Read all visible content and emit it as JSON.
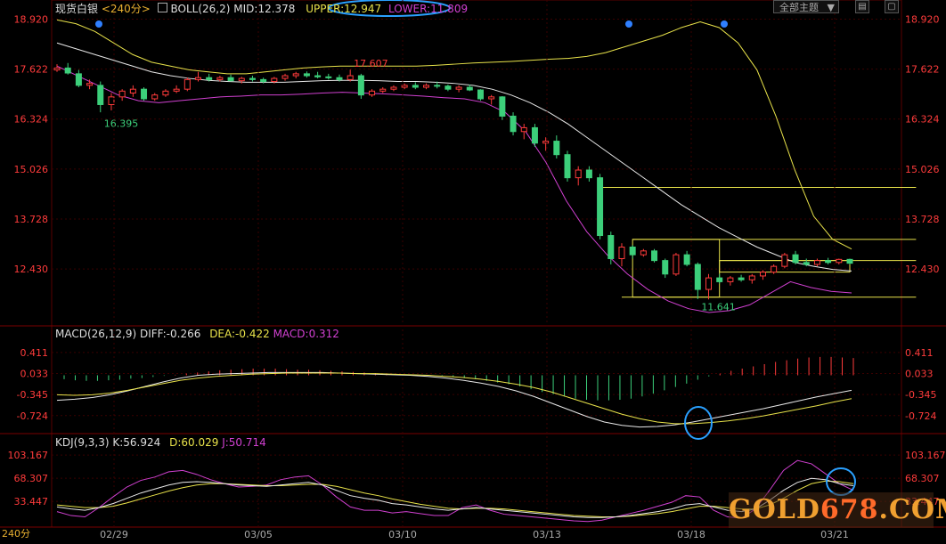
{
  "header": {
    "symbol": "现货白银",
    "period": "<240分>",
    "boll_label": "BOLL(26,2)",
    "mid_label": "MID:12.378",
    "upper_label": "UPPER:12.947",
    "lower_label": "LOWER:11.809",
    "theme_button": "全部主题",
    "win_buttons": [
      "▤",
      "▢"
    ]
  },
  "macd": {
    "label": "MACD(26,12,9)",
    "diff": "DIFF:-0.266",
    "dea": "DEA:-0.422",
    "macd": "MACD:0.312"
  },
  "kdj": {
    "label": "KDJ(9,3,3)",
    "k": "K:56.924",
    "d": "D:60.029",
    "j": "J:50.714"
  },
  "footer": {
    "period_tag": "240分"
  },
  "watermark": {
    "part1": "GOLD",
    "part2": "678",
    "part3": ".COM"
  },
  "colors": {
    "bull": "#ff3b3b",
    "bear": "#3ccf7a",
    "boll_upper": "#e8e24a",
    "boll_mid": "#e8e8e8",
    "boll_lower": "#d040d0",
    "axis_text": "#ff3b3b",
    "grid": "#3a0000",
    "annot": "#2f80ff"
  },
  "chart_data": [
    {
      "type": "candlestick",
      "title": "现货白银 240分",
      "y_ticks": [
        "18.920",
        "17.622",
        "16.324",
        "15.026",
        "13.728",
        "12.430"
      ],
      "ylim": [
        11.0,
        19.0
      ],
      "x_tick_labels": [
        "02/29",
        "03/05",
        "03/10",
        "03/13",
        "03/18",
        "03/21"
      ],
      "annotations": [
        {
          "text": "17.607",
          "x": 27,
          "y": 17.607,
          "color": "#ff3b3b"
        },
        {
          "text": "16.395",
          "x": 4,
          "y": 16.395,
          "color": "#3ccf7a"
        },
        {
          "text": "11.641",
          "x": 59,
          "y": 11.641,
          "color": "#3ccf7a"
        }
      ],
      "ohlc": [
        [
          17.6,
          17.75,
          17.55,
          17.65
        ],
        [
          17.65,
          17.78,
          17.48,
          17.52
        ],
        [
          17.5,
          17.6,
          17.15,
          17.2
        ],
        [
          17.2,
          17.35,
          17.1,
          17.25
        ],
        [
          17.2,
          17.3,
          16.5,
          16.7
        ],
        [
          16.7,
          17.0,
          16.55,
          16.9
        ],
        [
          16.9,
          17.1,
          16.8,
          17.05
        ],
        [
          17.0,
          17.2,
          16.9,
          17.1
        ],
        [
          17.1,
          17.15,
          16.8,
          16.85
        ],
        [
          16.85,
          17.0,
          16.8,
          16.95
        ],
        [
          16.95,
          17.1,
          16.9,
          17.05
        ],
        [
          17.05,
          17.2,
          17.0,
          17.1
        ],
        [
          17.1,
          17.4,
          17.05,
          17.35
        ],
        [
          17.35,
          17.55,
          17.3,
          17.4
        ],
        [
          17.4,
          17.5,
          17.3,
          17.35
        ],
        [
          17.35,
          17.45,
          17.3,
          17.4
        ],
        [
          17.4,
          17.48,
          17.3,
          17.32
        ],
        [
          17.32,
          17.42,
          17.25,
          17.38
        ],
        [
          17.38,
          17.45,
          17.3,
          17.35
        ],
        [
          17.35,
          17.4,
          17.25,
          17.3
        ],
        [
          17.3,
          17.42,
          17.25,
          17.38
        ],
        [
          17.38,
          17.5,
          17.32,
          17.45
        ],
        [
          17.45,
          17.55,
          17.38,
          17.5
        ],
        [
          17.5,
          17.56,
          17.4,
          17.45
        ],
        [
          17.45,
          17.55,
          17.38,
          17.42
        ],
        [
          17.42,
          17.5,
          17.35,
          17.4
        ],
        [
          17.4,
          17.48,
          17.3,
          17.35
        ],
        [
          17.35,
          17.607,
          17.3,
          17.45
        ],
        [
          17.45,
          17.5,
          16.85,
          16.95
        ],
        [
          16.95,
          17.1,
          16.9,
          17.05
        ],
        [
          17.05,
          17.15,
          17.0,
          17.1
        ],
        [
          17.1,
          17.2,
          17.05,
          17.15
        ],
        [
          17.15,
          17.25,
          17.1,
          17.2
        ],
        [
          17.2,
          17.28,
          17.1,
          17.15
        ],
        [
          17.15,
          17.25,
          17.1,
          17.2
        ],
        [
          17.2,
          17.3,
          17.12,
          17.18
        ],
        [
          17.18,
          17.22,
          17.05,
          17.1
        ],
        [
          17.1,
          17.2,
          17.02,
          17.15
        ],
        [
          17.15,
          17.22,
          17.05,
          17.08
        ],
        [
          17.08,
          17.1,
          16.8,
          16.85
        ],
        [
          16.85,
          16.95,
          16.7,
          16.9
        ],
        [
          16.9,
          16.92,
          16.3,
          16.4
        ],
        [
          16.4,
          16.5,
          15.9,
          16.0
        ],
        [
          16.0,
          16.2,
          15.8,
          16.1
        ],
        [
          16.1,
          16.2,
          15.6,
          15.7
        ],
        [
          15.7,
          15.85,
          15.5,
          15.75
        ],
        [
          15.75,
          15.9,
          15.3,
          15.4
        ],
        [
          15.4,
          15.5,
          14.7,
          14.8
        ],
        [
          14.8,
          15.1,
          14.6,
          15.0
        ],
        [
          15.0,
          15.1,
          14.7,
          14.8
        ],
        [
          14.8,
          14.9,
          13.2,
          13.3
        ],
        [
          13.3,
          13.4,
          12.55,
          12.7
        ],
        [
          12.7,
          13.1,
          12.5,
          13.0
        ],
        [
          13.0,
          13.05,
          12.7,
          12.8
        ],
        [
          12.8,
          12.95,
          12.75,
          12.9
        ],
        [
          12.9,
          12.95,
          12.6,
          12.65
        ],
        [
          12.65,
          12.7,
          12.2,
          12.3
        ],
        [
          12.3,
          12.85,
          12.25,
          12.8
        ],
        [
          12.8,
          12.9,
          12.5,
          12.55
        ],
        [
          12.55,
          12.6,
          11.65,
          11.9
        ],
        [
          11.9,
          12.3,
          11.641,
          12.2
        ],
        [
          12.2,
          12.3,
          12.05,
          12.1
        ],
        [
          12.1,
          12.25,
          12.0,
          12.2
        ],
        [
          12.2,
          12.28,
          12.1,
          12.15
        ],
        [
          12.15,
          12.3,
          12.05,
          12.25
        ],
        [
          12.25,
          12.4,
          12.15,
          12.35
        ],
        [
          12.35,
          12.55,
          12.3,
          12.5
        ],
        [
          12.5,
          12.85,
          12.45,
          12.8
        ],
        [
          12.8,
          12.9,
          12.55,
          12.6
        ],
        [
          12.6,
          12.7,
          12.5,
          12.55
        ],
        [
          12.55,
          12.7,
          12.5,
          12.65
        ],
        [
          12.65,
          12.72,
          12.55,
          12.6
        ],
        [
          12.6,
          12.7,
          12.55,
          12.68
        ],
        [
          12.68,
          12.7,
          12.55,
          12.58
        ]
      ],
      "boll": {
        "upper": [
          18.9,
          18.8,
          18.6,
          18.3,
          18.0,
          17.8,
          17.7,
          17.6,
          17.55,
          17.5,
          17.5,
          17.55,
          17.6,
          17.65,
          17.68,
          17.7,
          17.7,
          17.7,
          17.7,
          17.7,
          17.72,
          17.75,
          17.78,
          17.8,
          17.82,
          17.85,
          17.88,
          17.9,
          17.95,
          18.05,
          18.2,
          18.35,
          18.5,
          18.7,
          18.85,
          18.7,
          18.3,
          17.6,
          16.4,
          15.0,
          13.8,
          13.2,
          12.95
        ],
        "mid": [
          18.3,
          18.15,
          18.0,
          17.85,
          17.7,
          17.55,
          17.45,
          17.38,
          17.33,
          17.3,
          17.28,
          17.28,
          17.28,
          17.3,
          17.32,
          17.33,
          17.33,
          17.32,
          17.3,
          17.3,
          17.28,
          17.25,
          17.2,
          17.1,
          16.95,
          16.75,
          16.5,
          16.2,
          15.85,
          15.5,
          15.15,
          14.8,
          14.45,
          14.1,
          13.8,
          13.5,
          13.25,
          13.0,
          12.8,
          12.6,
          12.5,
          12.42,
          12.378
        ],
        "lower": [
          17.7,
          17.45,
          17.2,
          16.95,
          16.8,
          16.75,
          16.8,
          16.85,
          16.9,
          16.92,
          16.95,
          16.95,
          16.97,
          17.0,
          17.02,
          17.0,
          16.98,
          16.95,
          16.92,
          16.88,
          16.85,
          16.75,
          16.5,
          16.0,
          15.2,
          14.2,
          13.4,
          12.8,
          12.3,
          11.9,
          11.6,
          11.4,
          11.3,
          11.35,
          11.5,
          11.8,
          12.1,
          11.95,
          11.85,
          11.809
        ],
        "upper_start": 4,
        "lower_start": 4
      },
      "levels": [
        {
          "y": 14.55,
          "x0": 50,
          "x1": 75
        },
        {
          "y": 13.2,
          "x0": 53,
          "x1": 75
        },
        {
          "y": 12.65,
          "x0": 61,
          "x1": 75
        },
        {
          "y": 11.7,
          "x0": 52,
          "x1": 75
        }
      ],
      "boxes": [
        {
          "x0": 53,
          "x1": 61,
          "y0": 11.7,
          "y1": 13.2
        },
        {
          "x0": 61,
          "x1": 73,
          "y0": 12.35,
          "y1": 12.65
        }
      ]
    },
    {
      "type": "bar",
      "title": "MACD(26,12,9)",
      "y_ticks": [
        "0.411",
        "0.033",
        "-0.345",
        "-0.724"
      ],
      "ylim": [
        -1.0,
        0.6
      ],
      "hist": [
        -0.07,
        -0.09,
        -0.1,
        -0.1,
        -0.09,
        -0.08,
        -0.06,
        -0.05,
        -0.03,
        -0.01,
        0.01,
        0.03,
        0.05,
        0.07,
        0.09,
        0.1,
        0.11,
        0.12,
        0.12,
        0.12,
        0.11,
        0.1,
        0.1,
        0.09,
        0.08,
        0.07,
        0.06,
        0.05,
        0.04,
        0.03,
        0.02,
        0.01,
        0.0,
        -0.01,
        -0.02,
        -0.03,
        -0.05,
        -0.07,
        -0.1,
        -0.13,
        -0.16,
        -0.2,
        -0.25,
        -0.3,
        -0.34,
        -0.38,
        -0.42,
        -0.44,
        -0.45,
        -0.45,
        -0.44,
        -0.42,
        -0.38,
        -0.33,
        -0.27,
        -0.21,
        -0.15,
        -0.08,
        -0.02,
        0.03,
        0.08,
        0.12,
        0.16,
        0.2,
        0.24,
        0.27,
        0.3,
        0.32,
        0.33,
        0.33,
        0.32,
        0.31
      ],
      "diff": [
        -0.45,
        -0.43,
        -0.4,
        -0.35,
        -0.28,
        -0.2,
        -0.12,
        -0.05,
        0.0,
        0.02,
        0.03,
        0.04,
        0.05,
        0.05,
        0.05,
        0.05,
        0.04,
        0.03,
        0.02,
        0.01,
        0.0,
        -0.02,
        -0.05,
        -0.09,
        -0.14,
        -0.2,
        -0.28,
        -0.38,
        -0.5,
        -0.62,
        -0.74,
        -0.84,
        -0.9,
        -0.93,
        -0.92,
        -0.89,
        -0.84,
        -0.78,
        -0.72,
        -0.66,
        -0.6,
        -0.53,
        -0.46,
        -0.39,
        -0.33,
        -0.27
      ],
      "dea": [
        -0.35,
        -0.36,
        -0.35,
        -0.32,
        -0.27,
        -0.21,
        -0.15,
        -0.09,
        -0.05,
        -0.02,
        0.0,
        0.02,
        0.03,
        0.04,
        0.04,
        0.04,
        0.04,
        0.03,
        0.03,
        0.02,
        0.01,
        0.0,
        -0.02,
        -0.04,
        -0.07,
        -0.11,
        -0.16,
        -0.22,
        -0.3,
        -0.4,
        -0.5,
        -0.6,
        -0.7,
        -0.78,
        -0.84,
        -0.87,
        -0.87,
        -0.85,
        -0.82,
        -0.78,
        -0.73,
        -0.67,
        -0.61,
        -0.55,
        -0.48,
        -0.42
      ],
      "annotations_circle": [
        {
          "x": 0.53
        }
      ]
    },
    {
      "type": "line",
      "title": "KDJ(9,3,3)",
      "y_ticks": [
        "103.167",
        "68.307",
        "33.447"
      ],
      "ylim": [
        0,
        110
      ],
      "k": [
        25,
        22,
        20,
        24,
        30,
        38,
        46,
        52,
        58,
        62,
        63,
        62,
        60,
        58,
        57,
        56,
        58,
        60,
        62,
        58,
        50,
        42,
        38,
        35,
        30,
        28,
        25,
        22,
        20,
        22,
        24,
        22,
        20,
        18,
        16,
        14,
        12,
        10,
        9,
        9,
        10,
        12,
        15,
        18,
        22,
        28,
        30,
        25,
        20,
        18,
        22,
        35,
        50,
        62,
        68,
        66,
        60,
        57
      ],
      "d": [
        28,
        26,
        24,
        24,
        26,
        31,
        37,
        43,
        49,
        54,
        58,
        60,
        60,
        59,
        58,
        57,
        57,
        58,
        59,
        59,
        56,
        51,
        46,
        42,
        37,
        33,
        29,
        26,
        23,
        22,
        23,
        23,
        22,
        20,
        18,
        16,
        14,
        12,
        11,
        10,
        10,
        11,
        13,
        15,
        18,
        22,
        26,
        26,
        24,
        22,
        22,
        28,
        38,
        50,
        60,
        64,
        63,
        60
      ],
      "j": [
        18,
        12,
        10,
        24,
        40,
        55,
        65,
        70,
        78,
        80,
        74,
        66,
        60,
        55,
        56,
        58,
        66,
        70,
        72,
        58,
        40,
        25,
        20,
        20,
        16,
        18,
        15,
        12,
        12,
        24,
        28,
        20,
        14,
        12,
        10,
        8,
        6,
        4,
        3,
        5,
        10,
        15,
        20,
        26,
        32,
        42,
        40,
        20,
        10,
        8,
        22,
        50,
        80,
        95,
        90,
        75,
        60,
        50
      ]
    }
  ]
}
